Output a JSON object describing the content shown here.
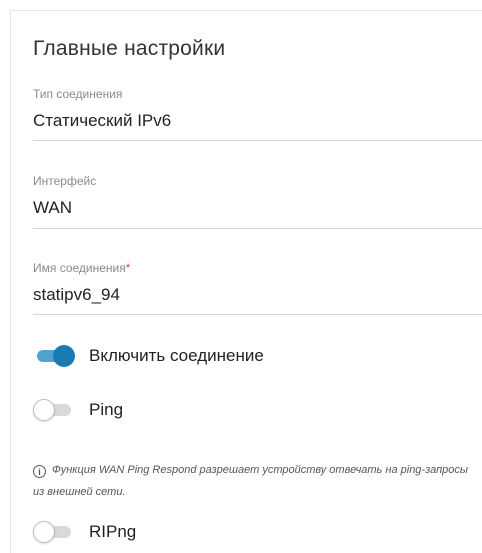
{
  "section": {
    "title": "Главные настройки"
  },
  "fields": {
    "connection_type": {
      "label": "Тип соединения",
      "value": "Статический IPv6"
    },
    "interface": {
      "label": "Интерфейс",
      "value": "WAN"
    },
    "connection_name": {
      "label": "Имя соединения",
      "required_mark": "*",
      "value": "statipv6_94"
    }
  },
  "toggles": {
    "enable_connection": {
      "label": "Включить соединение",
      "state": "on"
    },
    "ping": {
      "label": "Ping",
      "state": "off"
    },
    "ripng": {
      "label": "RIPng",
      "state": "off"
    }
  },
  "hint": {
    "icon": "info-icon",
    "text": "Функция WAN Ping Respond разрешает устройству отвечать на ping-запросы из внешней сети."
  },
  "colors": {
    "accent": "#1a7bb3",
    "accent_track": "#4fa3d1",
    "required": "#e04a3a"
  }
}
